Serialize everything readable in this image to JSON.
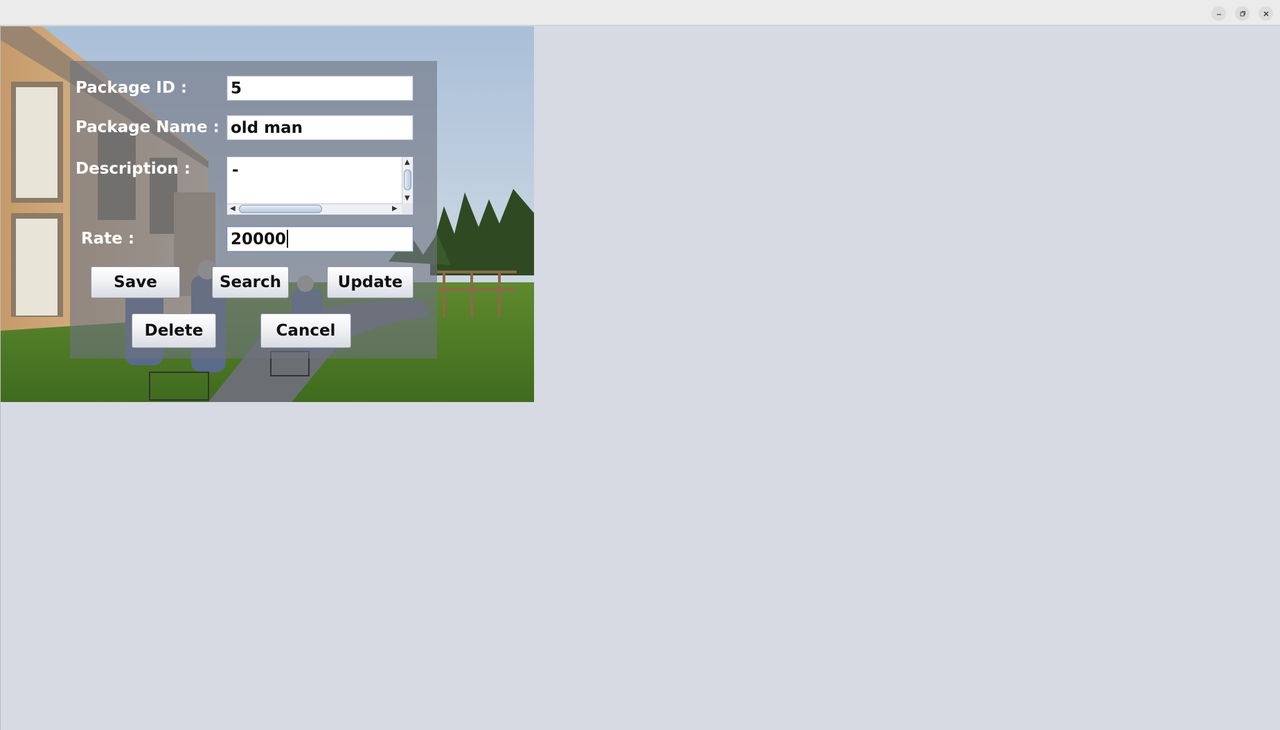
{
  "window": {
    "controls": [
      "minimize-icon",
      "restore-icon",
      "close-icon"
    ]
  },
  "form": {
    "package_id": {
      "label": "Package ID :",
      "value": "5"
    },
    "package_name": {
      "label": "Package Name :",
      "value": "old man"
    },
    "description": {
      "label": "Description :",
      "value": "-"
    },
    "rate": {
      "label": "Rate :",
      "value": "20000"
    }
  },
  "buttons": {
    "save": "Save",
    "search": "Search",
    "update": "Update",
    "delete": "Delete",
    "cancel": "Cancel"
  },
  "colors": {
    "background": "#d7dae2",
    "panel_overlay": "#6e7380",
    "label_text": "#ffffff"
  }
}
